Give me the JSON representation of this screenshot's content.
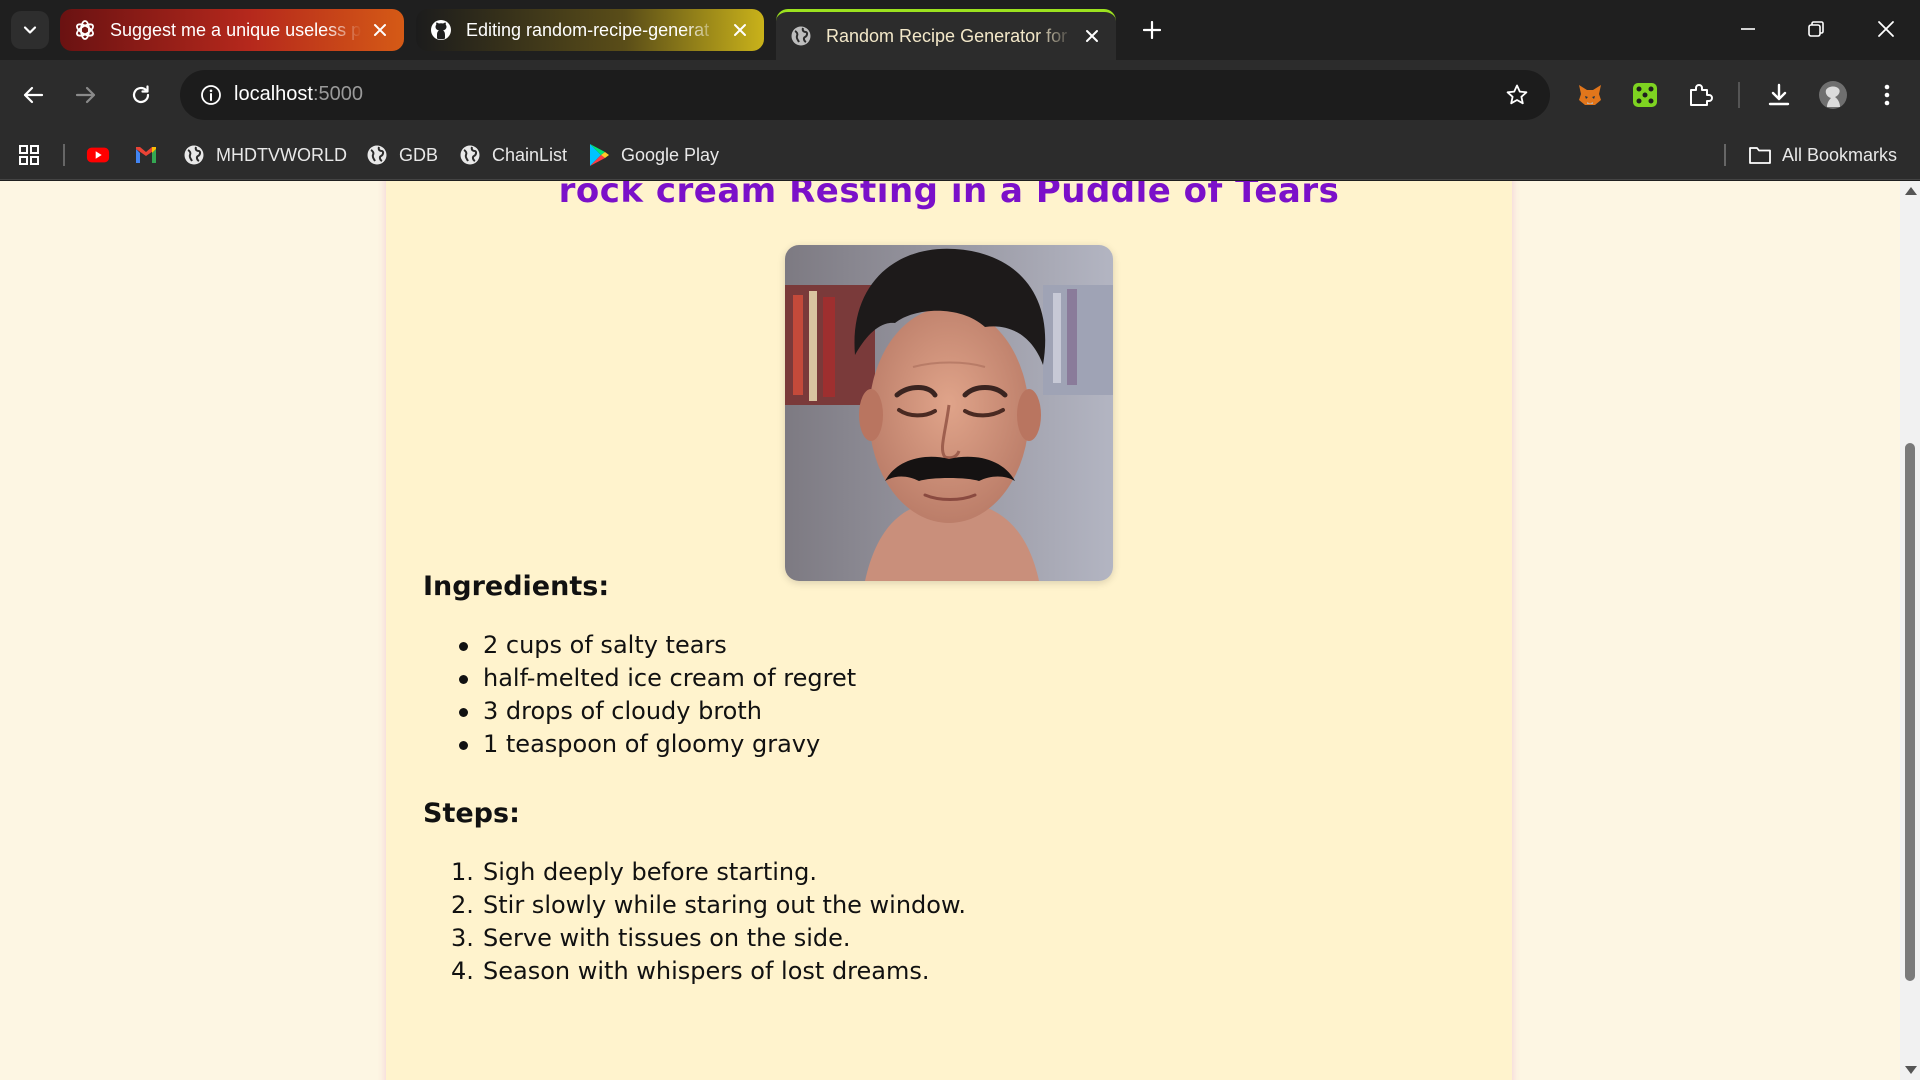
{
  "browser": {
    "tabs": [
      {
        "title": "Suggest me a unique useless pr",
        "icon": "openai-icon",
        "active": false
      },
      {
        "title": "Editing random-recipe-generat",
        "icon": "github-icon",
        "active": false
      },
      {
        "title": "Random Recipe Generator for F",
        "icon": "globe-icon",
        "active": true
      }
    ],
    "address": {
      "host": "localhost",
      "port": ":5000"
    },
    "bookmarks": [
      {
        "label": "",
        "icon": "youtube-icon"
      },
      {
        "label": "",
        "icon": "gmail-icon"
      },
      {
        "label": "MHDTVWORLD",
        "icon": "globe-icon"
      },
      {
        "label": "GDB",
        "icon": "globe-icon"
      },
      {
        "label": "ChainList",
        "icon": "globe-icon"
      },
      {
        "label": "Google Play",
        "icon": "google-play-icon"
      }
    ],
    "all_bookmarks_label": "All Bookmarks",
    "colors": {
      "accent_tab": "#9ce21f",
      "title": "#7b10c9",
      "page_bg": "#fdf6e3",
      "card_bg": "#fff3cd"
    }
  },
  "recipe": {
    "title": "rock cream Resting in a Puddle of Tears",
    "image_icon": "crying-man-photo",
    "ingredients_heading": "Ingredients:",
    "ingredients": [
      "2 cups of salty tears",
      "half-melted ice cream of regret",
      "3 drops of cloudy broth",
      "1 teaspoon of gloomy gravy"
    ],
    "steps_heading": "Steps:",
    "steps": [
      {
        "num": "1.",
        "text": "Sigh deeply before starting."
      },
      {
        "num": "2.",
        "text": "Stir slowly while staring out the window."
      },
      {
        "num": "3.",
        "text": "Serve with tissues on the side."
      },
      {
        "num": "4.",
        "text": "Season with whispers of lost dreams."
      }
    ]
  }
}
